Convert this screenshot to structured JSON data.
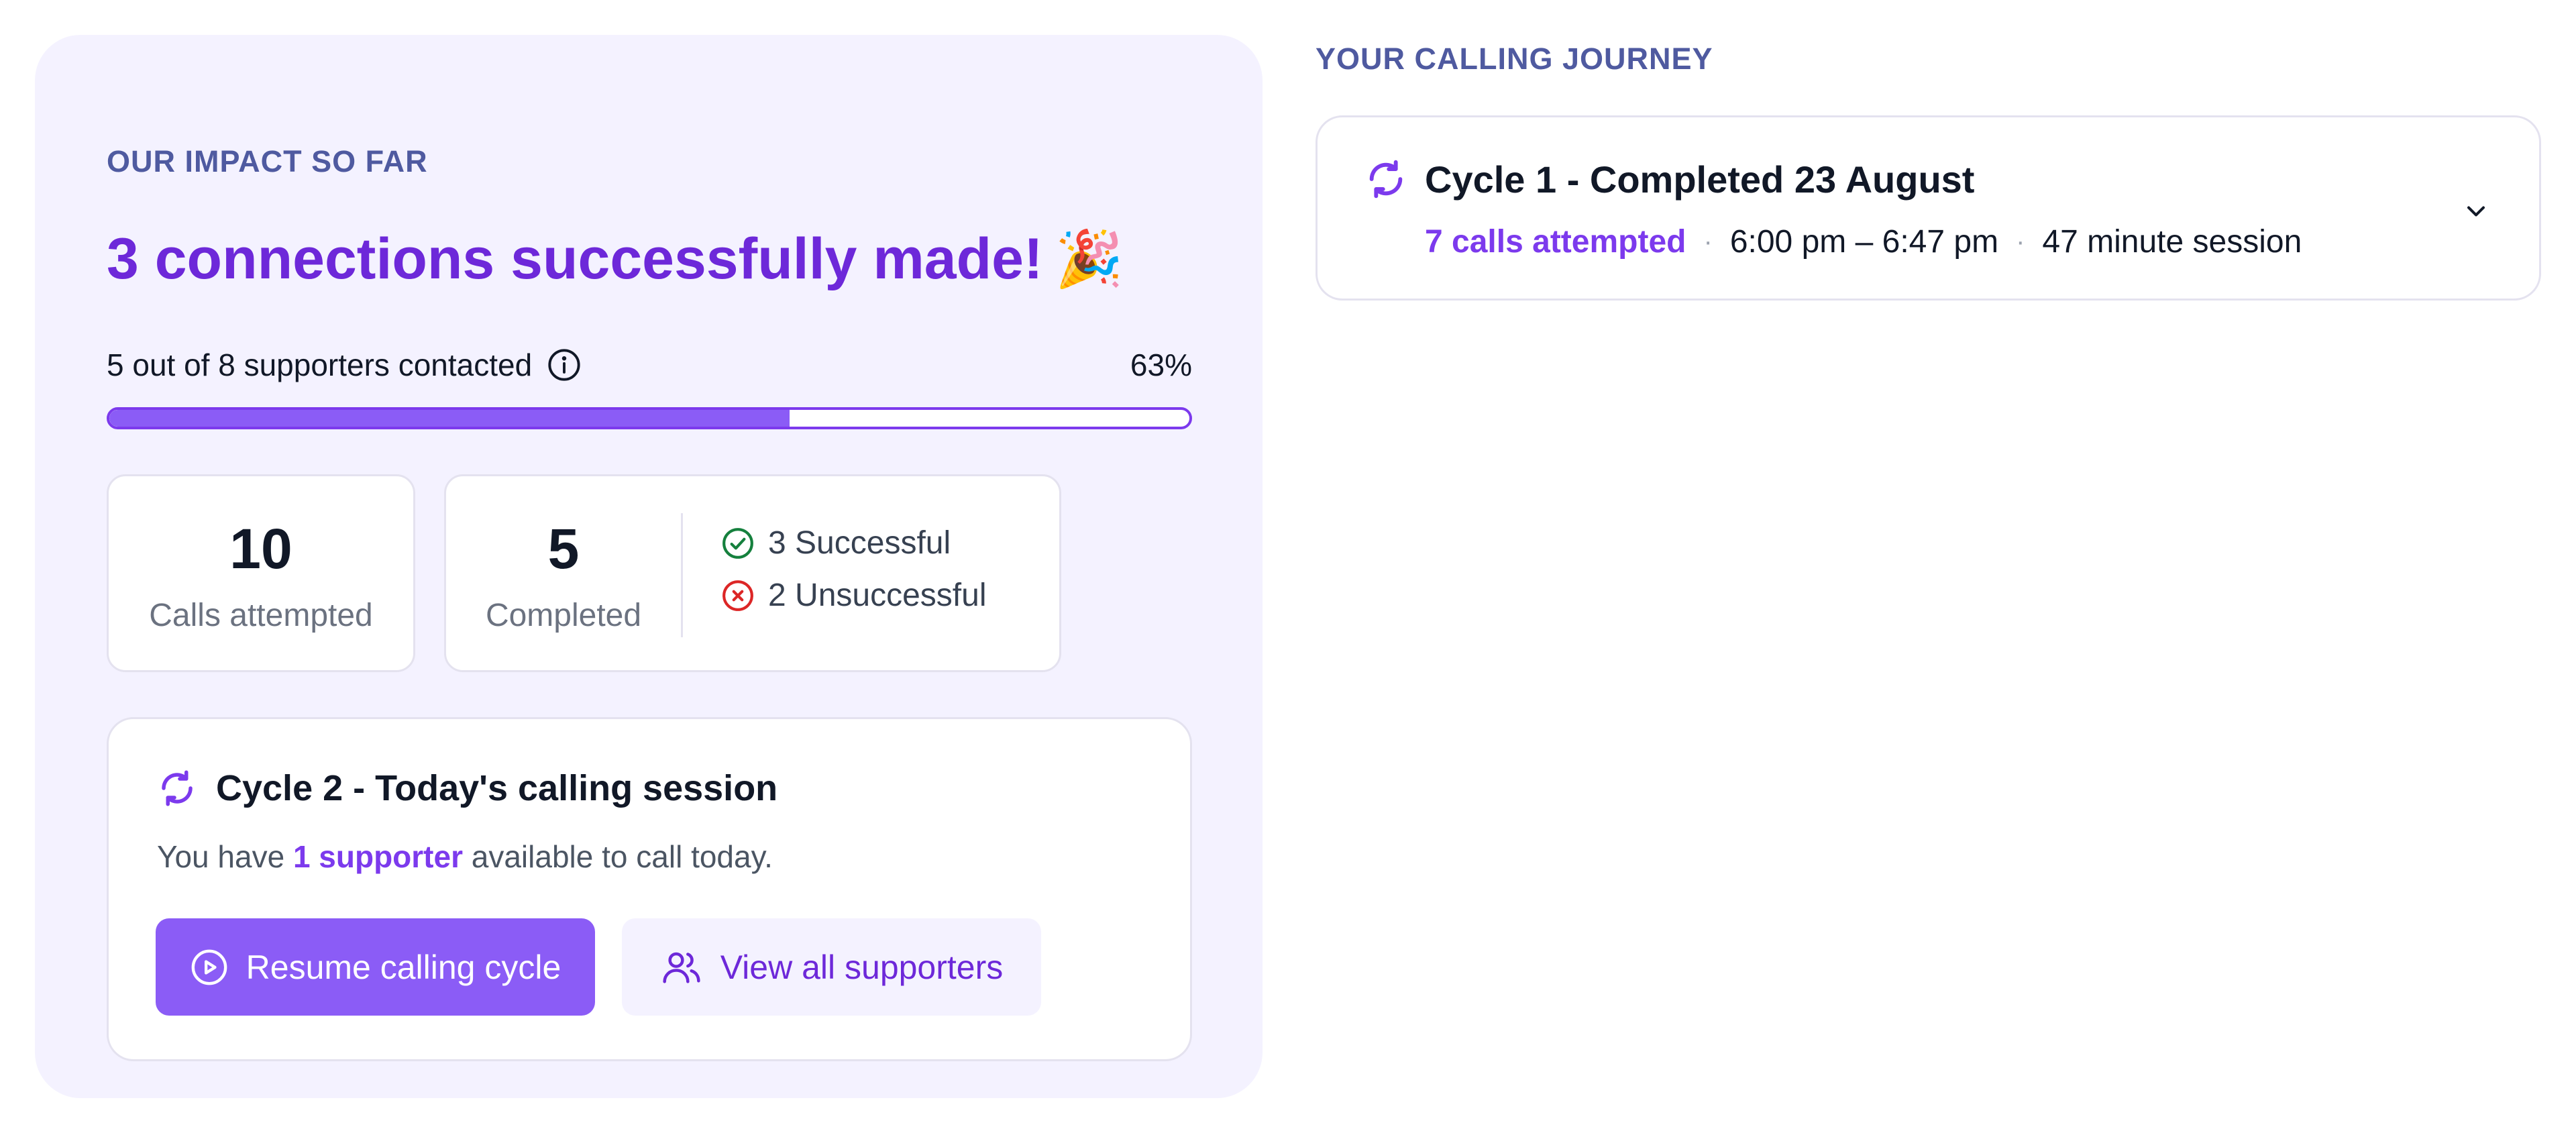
{
  "impact": {
    "eyebrow": "OUR IMPACT SO FAR",
    "headline": "3 connections successfully made!",
    "headline_emoji": "🎉",
    "progress": {
      "label": "5 out of 8 supporters contacted",
      "percent_text": "63%",
      "fraction": 0.63
    },
    "stats": {
      "calls_attempted": {
        "value": "10",
        "caption": "Calls attempted"
      },
      "completed": {
        "value": "5",
        "caption": "Completed"
      },
      "successful_text": "3 Successful",
      "unsuccessful_text": "2 Unsuccessful"
    },
    "session": {
      "title": "Cycle 2 - Today's calling session",
      "text_before": "You have ",
      "highlight": "1 supporter",
      "text_after": " available to call today.",
      "resume_label": "Resume calling cycle",
      "view_label": "View all supporters"
    }
  },
  "journey": {
    "eyebrow": "YOUR CALLING JOURNEY",
    "cycles": [
      {
        "title": "Cycle 1 - Completed 23 August",
        "calls": "7 calls attempted",
        "time": "6:00 pm – 6:47 pm",
        "duration": "47 minute session"
      }
    ]
  },
  "colors": {
    "accent": "#8b5cf6",
    "accent_dark": "#6d28d9",
    "panel_bg": "#f4f2ff",
    "eyebrow": "#4f5aa0",
    "success": "#15803d",
    "error": "#dc2626"
  },
  "icons": {
    "info": "info-icon",
    "success": "check-circle-icon",
    "fail": "x-circle-icon",
    "cycle": "refresh-icon",
    "play": "play-circle-icon",
    "users": "users-icon",
    "chevron": "chevron-down-icon"
  }
}
